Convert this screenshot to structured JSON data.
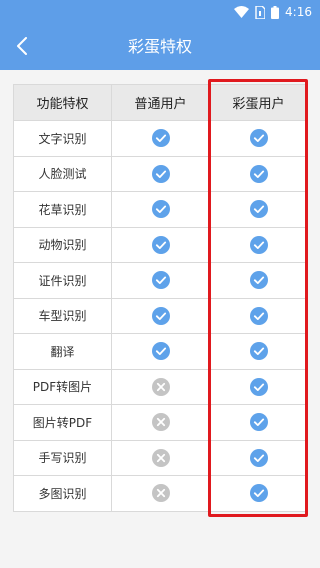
{
  "status_bar": {
    "time": "4:16",
    "icons": [
      "wifi-icon",
      "sim-card-icon",
      "battery-icon"
    ]
  },
  "nav": {
    "back_icon": "chevron-left-icon",
    "title": "彩蛋特权"
  },
  "table": {
    "headers": [
      "功能特权",
      "普通用户",
      "彩蛋用户"
    ],
    "rows": [
      {
        "feature": "文字识别",
        "normal": "check",
        "egg": "check"
      },
      {
        "feature": "人脸测试",
        "normal": "check",
        "egg": "check"
      },
      {
        "feature": "花草识别",
        "normal": "check",
        "egg": "check"
      },
      {
        "feature": "动物识别",
        "normal": "check",
        "egg": "check"
      },
      {
        "feature": "证件识别",
        "normal": "check",
        "egg": "check"
      },
      {
        "feature": "车型识别",
        "normal": "check",
        "egg": "check"
      },
      {
        "feature": "翻译",
        "normal": "check",
        "egg": "check"
      },
      {
        "feature": "PDF转图片",
        "normal": "cross",
        "egg": "check"
      },
      {
        "feature": "图片转PDF",
        "normal": "cross",
        "egg": "check"
      },
      {
        "feature": "手写识别",
        "normal": "cross",
        "egg": "check"
      },
      {
        "feature": "多图识别",
        "normal": "cross",
        "egg": "check"
      }
    ]
  },
  "colors": {
    "header_bg": "#5e9ee8",
    "check": "#5ea2ea",
    "cross": "#c4c4c4",
    "highlight": "#e0191e"
  }
}
